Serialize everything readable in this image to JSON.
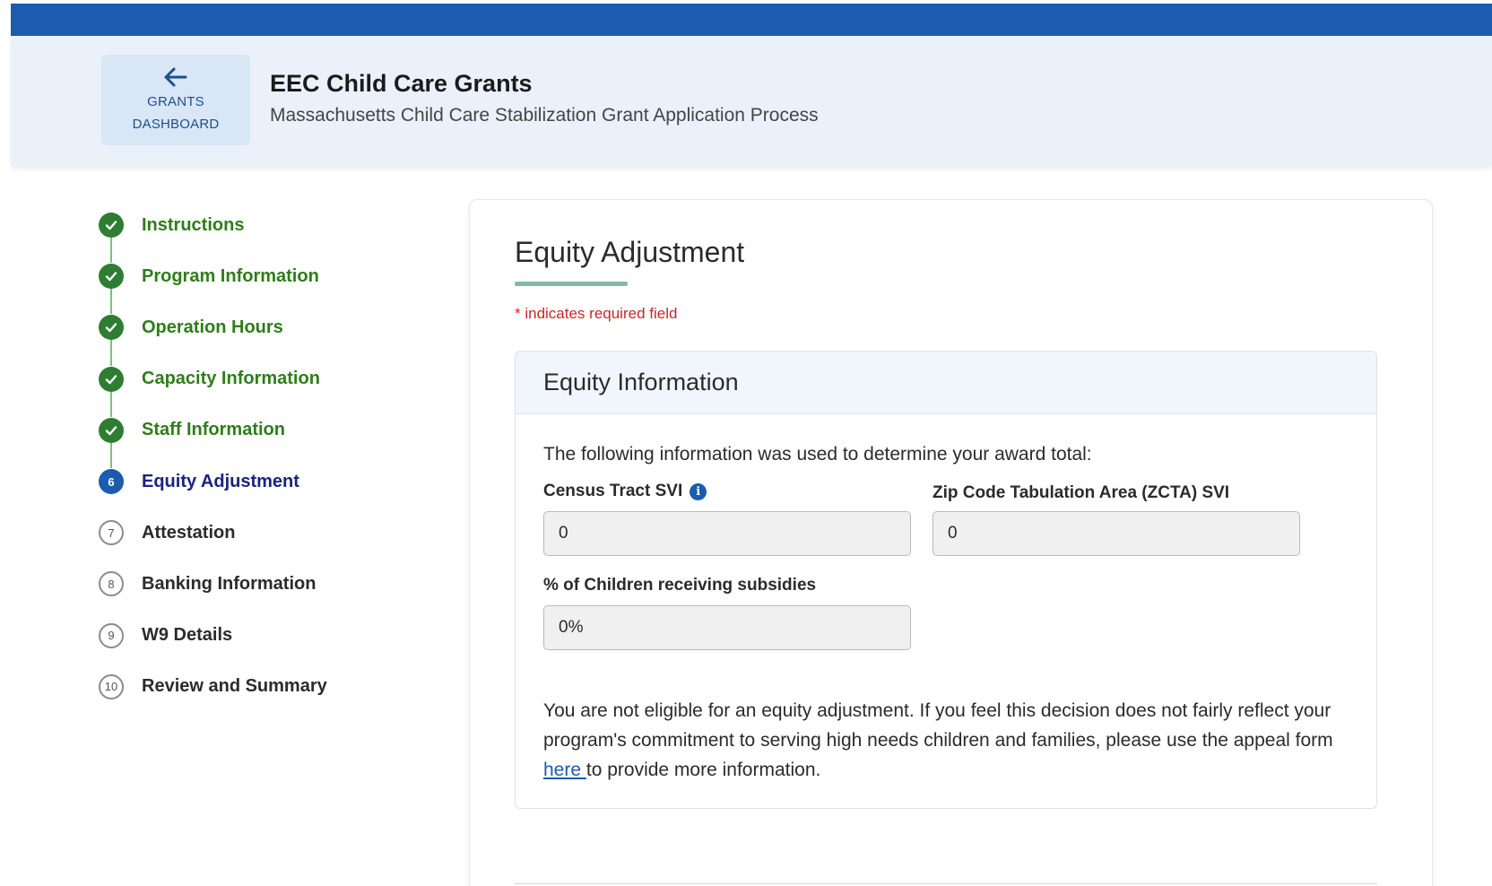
{
  "header": {
    "back_button": {
      "line1": "GRANTS",
      "line2": "DASHBOARD",
      "icon": "arrow-left-icon"
    },
    "title": "EEC Child Care Grants",
    "subtitle": "Massachusetts Child Care Stabilization Grant Application Process"
  },
  "steps": [
    {
      "label": "Instructions",
      "status": "done",
      "marker": ""
    },
    {
      "label": "Program Information",
      "status": "done",
      "marker": ""
    },
    {
      "label": "Operation Hours",
      "status": "done",
      "marker": ""
    },
    {
      "label": "Capacity Information",
      "status": "done",
      "marker": ""
    },
    {
      "label": "Staff Information",
      "status": "done",
      "marker": ""
    },
    {
      "label": "Equity Adjustment",
      "status": "current",
      "marker": "6"
    },
    {
      "label": "Attestation",
      "status": "todo",
      "marker": "7"
    },
    {
      "label": "Banking Information",
      "status": "todo",
      "marker": "8"
    },
    {
      "label": "W9 Details",
      "status": "todo",
      "marker": "9"
    },
    {
      "label": "Review and Summary",
      "status": "todo",
      "marker": "10"
    }
  ],
  "main": {
    "title": "Equity Adjustment",
    "required_note": "* indicates required field",
    "panel": {
      "title": "Equity Information",
      "intro": "The following information was used to determine your award total:",
      "fields": {
        "census_tract": {
          "label": "Census Tract SVI",
          "value": "0"
        },
        "zcta": {
          "label": "Zip Code Tabulation Area (ZCTA) SVI",
          "value": "0"
        },
        "subsidies": {
          "label": "% of Children receiving subsidies",
          "value": "0%"
        }
      },
      "notice": {
        "before": "You are not eligible for an equity adjustment. If you feel this decision does not fairly reflect your program's commitment to serving high needs children and families, please use the appeal form ",
        "link": "here ",
        "after": "to provide more information."
      }
    }
  },
  "colors": {
    "topbar": "#1b5cae",
    "done": "#2e7d32",
    "current": "#1b5cae",
    "required": "#c62828"
  }
}
